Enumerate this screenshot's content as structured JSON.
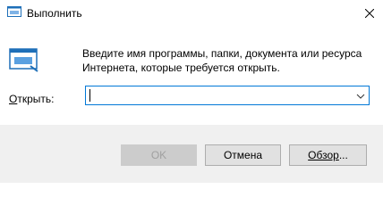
{
  "window": {
    "title": "Выполнить",
    "icon": "run-icon",
    "close_icon": "close-icon"
  },
  "dialog": {
    "description": "Введите имя программы, папки, документа или ресурса Интернета, которые требуется открыть.",
    "open_label_prefix": "О",
    "open_label_rest": "ткрыть:",
    "input_value": ""
  },
  "buttons": {
    "ok_label": "OK",
    "cancel_label": "Отмена",
    "browse_label_prefix": "Обзор",
    "browse_label_suffix": "..."
  },
  "colors": {
    "accent": "#0078d7",
    "footer_bg": "#f0f0f0"
  }
}
